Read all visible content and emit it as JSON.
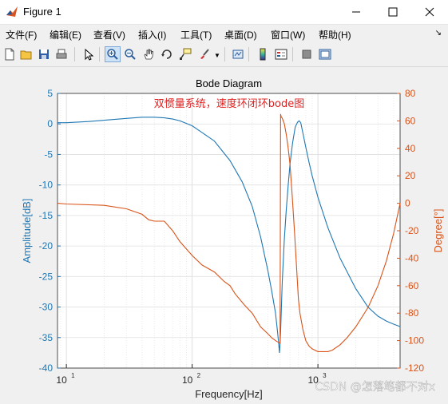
{
  "window": {
    "title": "Figure 1"
  },
  "menu": [
    "文件(F)",
    "编辑(E)",
    "查看(V)",
    "插入(I)",
    "工具(T)",
    "桌面(D)",
    "窗口(W)",
    "帮助(H)"
  ],
  "toolbar_icons": [
    "new-figure-icon",
    "open-file-icon",
    "save-icon",
    "print-icon",
    "pointer-icon",
    "zoom-in-icon",
    "zoom-out-icon",
    "pan-icon",
    "rotate-3d-icon",
    "data-cursor-icon",
    "brush-icon",
    "link-plot-icon",
    "colorbar-icon",
    "legend-icon",
    "hide-plot-tools-icon",
    "show-plot-tools-icon"
  ],
  "colors": {
    "amp": "#1f77b4",
    "phase": "#d95319",
    "annotation": "#e02020"
  },
  "watermark": "CSDN @怎落笔都不对x",
  "chart_data": {
    "type": "line",
    "title": "Bode Diagram",
    "annotation": "双惯量系统，速度环闭环bode图",
    "xlabel": "Frequency[Hz]",
    "ylabel_left": "Amplitude[dB]",
    "ylabel_right": "Degree[°]",
    "xscale": "log",
    "xlim": [
      8.5,
      4500
    ],
    "ylim_left": [
      -40,
      5
    ],
    "ylim_right": [
      -120,
      80
    ],
    "xticks": [
      {
        "label": "10",
        "exp": "1"
      },
      {
        "label": "10",
        "exp": "2"
      },
      {
        "label": "10",
        "exp": "3"
      }
    ],
    "yticks_left": [
      "5",
      "0",
      "-5",
      "-10",
      "-15",
      "-20",
      "-25",
      "-30",
      "-35",
      "-40"
    ],
    "yticks_right": [
      "80",
      "60",
      "40",
      "20",
      "0",
      "-20",
      "-40",
      "-60",
      "-80",
      "-100",
      "-120"
    ],
    "grid": true,
    "series": [
      {
        "axis": "left",
        "x": [
          8.5,
          10,
          15,
          20,
          30,
          40,
          50,
          60,
          70,
          80,
          100,
          150,
          200,
          250,
          300,
          350,
          400,
          430,
          460,
          480,
          495,
          505,
          520,
          540,
          560,
          580,
          600,
          630,
          660,
          690,
          710,
          730,
          760,
          800,
          850,
          900,
          1000,
          1200,
          1500,
          2000,
          2500,
          3000,
          3500,
          4000,
          4500
        ],
        "y": [
          0.2,
          0.2,
          0.4,
          0.6,
          0.9,
          1.1,
          1.1,
          1.0,
          0.8,
          0.5,
          -0.3,
          -2.8,
          -6.0,
          -9.5,
          -13.5,
          -18.5,
          -24.0,
          -27.5,
          -31.0,
          -34.5,
          -37.5,
          -34.0,
          -26.0,
          -19.0,
          -14.0,
          -10.0,
          -6.5,
          -3.0,
          -0.5,
          0.3,
          0.5,
          0.2,
          -1.5,
          -3.8,
          -6.3,
          -8.5,
          -12.0,
          -17.0,
          -22.0,
          -27.0,
          -30.0,
          -31.5,
          -32.3,
          -32.8,
          -33.2
        ]
      },
      {
        "axis": "right",
        "x": [
          8.5,
          10,
          20,
          30,
          40,
          45,
          50,
          60,
          70,
          80,
          100,
          120,
          150,
          180,
          200,
          220,
          260,
          300,
          350,
          400,
          430,
          460,
          480,
          500,
          505,
          510,
          520,
          540,
          560,
          580,
          600,
          620,
          650,
          680,
          700,
          720,
          760,
          800,
          850,
          900,
          1000,
          1100,
          1200,
          1300,
          1500,
          1700,
          2000,
          2500,
          3000,
          3500,
          4000,
          4500
        ],
        "y": [
          0,
          -0.5,
          -1.5,
          -4,
          -8,
          -12,
          -13,
          -13,
          -20,
          -28,
          -38,
          -45,
          -50,
          -57,
          -60,
          -66,
          -74,
          -80,
          -90,
          -95,
          -98,
          -100,
          -101,
          -102,
          65,
          63,
          62,
          58,
          50,
          40,
          28,
          10,
          -20,
          -50,
          -70,
          -80,
          -92,
          -100,
          -104,
          -106,
          -108,
          -108,
          -108,
          -107,
          -103,
          -98,
          -90,
          -76,
          -60,
          -42,
          -22,
          0
        ]
      }
    ]
  }
}
